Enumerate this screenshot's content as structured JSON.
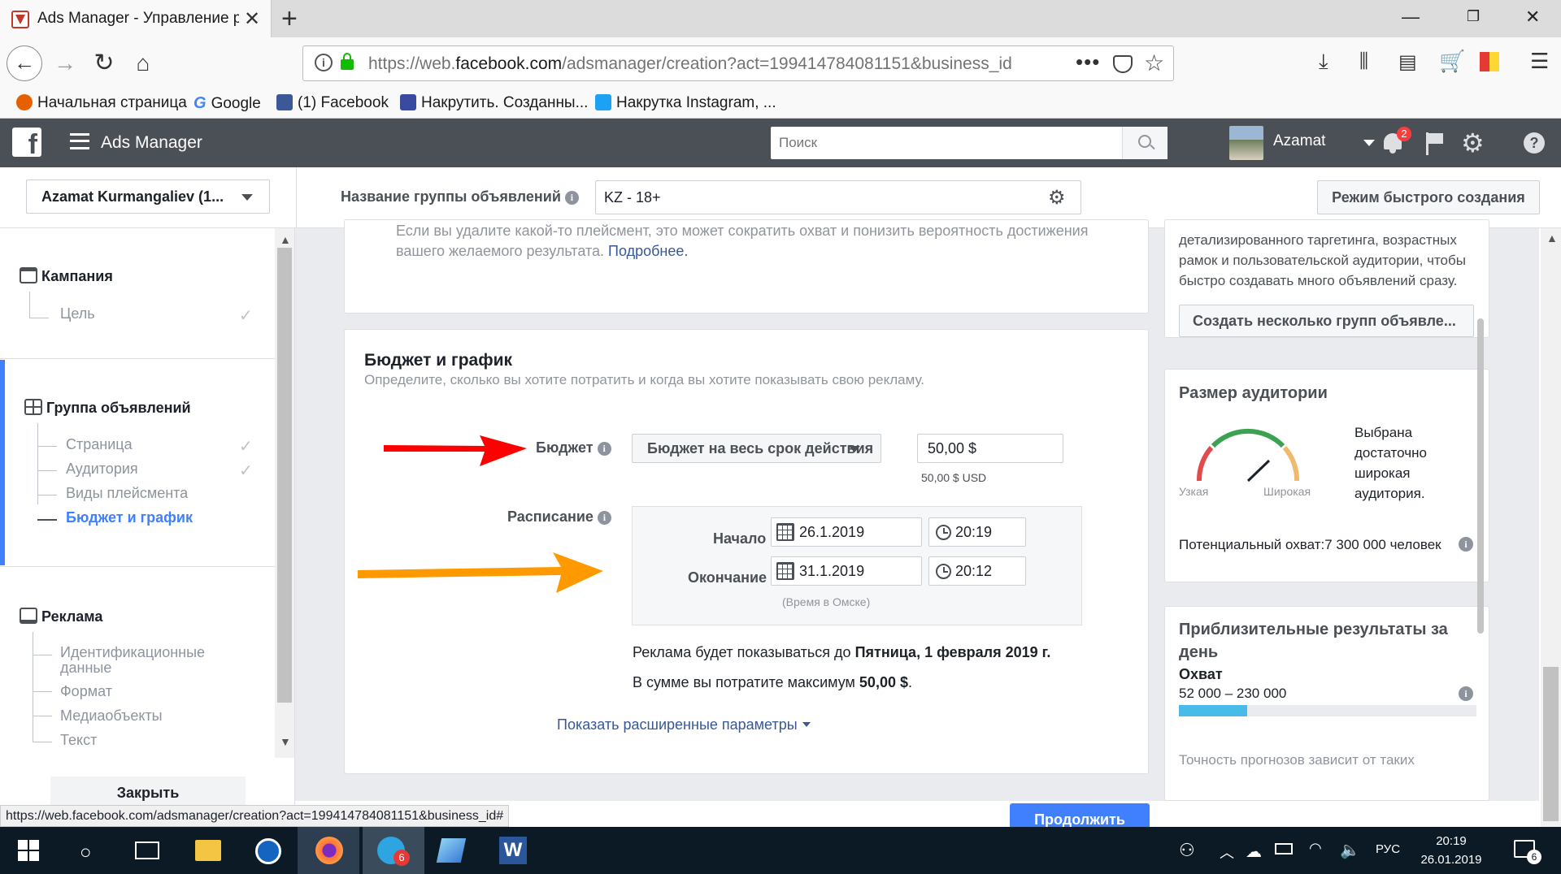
{
  "browser": {
    "tab_title": "Ads Manager - Управление ре",
    "url_prefix": "https://web.",
    "url_domain": "facebook.com",
    "url_rest": "/adsmanager/creation?act=199414784081151&business_id",
    "bookmarks": [
      {
        "label": "Начальная страница",
        "color": "#e66000"
      },
      {
        "label": "Google",
        "color": "#4285f4"
      },
      {
        "label": "(1) Facebook",
        "color": "#3b5998"
      },
      {
        "label": "Накрутить. Созданны...",
        "color": "#3a4aa0"
      },
      {
        "label": "Накрутка Instagram, ...",
        "color": "#1da1f2"
      }
    ]
  },
  "fb_header": {
    "app_title": "Ads Manager",
    "search_placeholder": "Поиск",
    "user_name": "Azamat",
    "notification_count": "2"
  },
  "subheader": {
    "account": "Azamat Kurmangaliev (1...",
    "group_name_label": "Название группы объявлений",
    "group_name_value": "KZ - 18+",
    "quick_mode": "Режим быстрого создания"
  },
  "sidebar": {
    "campaign": {
      "label": "Кампания",
      "items": [
        {
          "label": "Цель",
          "done": true
        }
      ]
    },
    "adset": {
      "label": "Группа объявлений",
      "items": [
        {
          "label": "Страница",
          "done": true
        },
        {
          "label": "Аудитория",
          "done": true
        },
        {
          "label": "Виды плейсмента",
          "done": false
        },
        {
          "label": "Бюджет и график",
          "done": false,
          "active": true
        }
      ]
    },
    "ad": {
      "label": "Реклама",
      "items": [
        {
          "label": "Идентификационные данные"
        },
        {
          "label": "Формат"
        },
        {
          "label": "Медиаобъекты"
        },
        {
          "label": "Текст"
        }
      ]
    },
    "close": "Закрыть"
  },
  "placement_note": {
    "text": "Если вы удалите какой-то плейсмент, это может сократить охват и понизить вероятность достижения вашего желаемого результата.",
    "link": "Подробнее."
  },
  "budget_section": {
    "title": "Бюджет и график",
    "subtitle": "Определите, сколько вы хотите потратить и когда вы хотите показывать свою рекламу.",
    "budget_label": "Бюджет",
    "budget_type": "Бюджет на весь срок действия",
    "budget_value": "50,00 $",
    "budget_usd": "50,00 $ USD",
    "schedule_label": "Расписание",
    "start_label": "Начало",
    "start_date": "26.1.2019",
    "start_time": "20:19",
    "end_label": "Окончание",
    "end_date": "31.1.2019",
    "end_time": "20:12",
    "timezone": "(Время в Омске)",
    "run_text_prefix": "Реклама будет показываться до ",
    "run_text_date": "Пятница, 1 февраля 2019 г.",
    "spend_prefix": "В сумме вы потратите максимум ",
    "spend_value": "50,00 $",
    "advanced": "Показать расширенные параметры",
    "continue": "Продолжить"
  },
  "right_panel": {
    "multi_text": "детализированного таргетинга, возрастных рамок и пользовательской аудитории, чтобы быстро создавать много объявлений сразу.",
    "multi_button": "Создать несколько групп объявле...",
    "audience_title": "Размер аудитории",
    "gauge_narrow": "Узкая",
    "gauge_wide": "Широкая",
    "audience_desc": "Выбрана достаточно широкая аудитория.",
    "potential_reach": "Потенциальный охват:7 300 000 человек",
    "estimate_title": "Приблизительные результаты за день",
    "coverage_label": "Охват",
    "coverage_range": "52 000 – 230 000",
    "coverage_fill": 0.23,
    "accuracy_note": "Точность прогнозов зависит от таких"
  },
  "status_url": "https://web.facebook.com/adsmanager/creation?act=199414784081151&business_id#",
  "taskbar": {
    "language": "РУС",
    "time": "20:19",
    "date": "26.01.2019",
    "telegram_badge": "6",
    "notifications_badge": "6"
  },
  "colors": {
    "fb_header": "#4b4f56",
    "link": "#365899",
    "active": "#4080ff",
    "arrow_red": "#ff0000",
    "arrow_orange": "#ff9900"
  }
}
